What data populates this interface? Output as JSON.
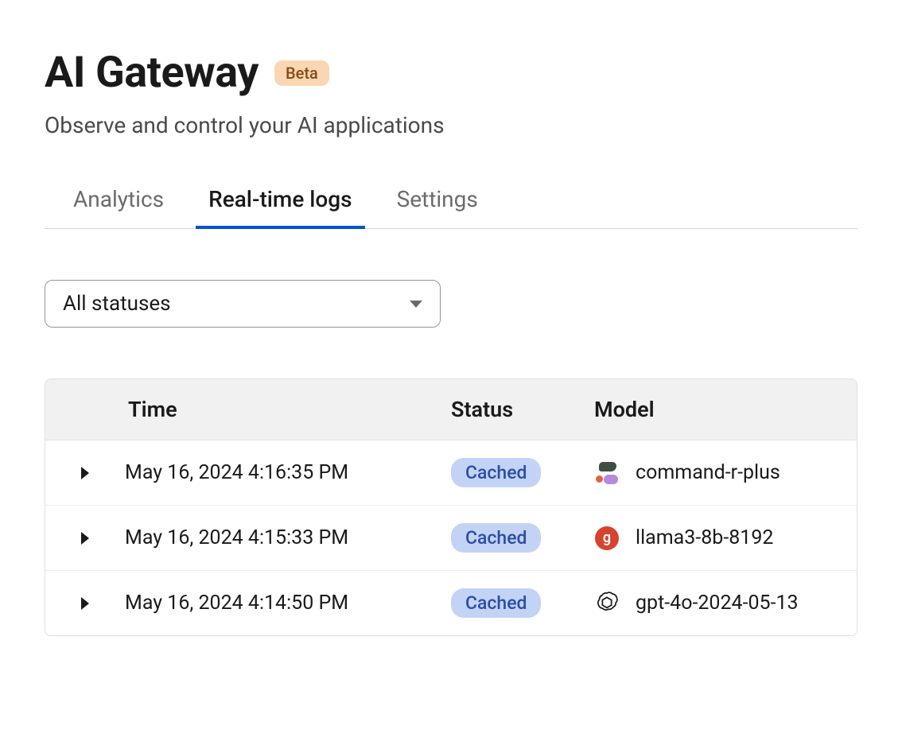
{
  "header": {
    "title": "AI Gateway",
    "badge": "Beta",
    "subtitle": "Observe and control your AI applications"
  },
  "tabs": [
    {
      "label": "Analytics",
      "active": false
    },
    {
      "label": "Real-time logs",
      "active": true
    },
    {
      "label": "Settings",
      "active": false
    }
  ],
  "filter": {
    "selected": "All statuses"
  },
  "table": {
    "columns": {
      "time": "Time",
      "status": "Status",
      "model": "Model"
    },
    "rows": [
      {
        "time": "May 16, 2024 4:16:35 PM",
        "status": "Cached",
        "model": "command-r-plus",
        "provider": "cohere"
      },
      {
        "time": "May 16, 2024 4:15:33 PM",
        "status": "Cached",
        "model": "llama3-8b-8192",
        "provider": "groq"
      },
      {
        "time": "May 16, 2024 4:14:50 PM",
        "status": "Cached",
        "model": "gpt-4o-2024-05-13",
        "provider": "openai"
      }
    ]
  },
  "icons": {
    "groq_glyph": "g"
  }
}
